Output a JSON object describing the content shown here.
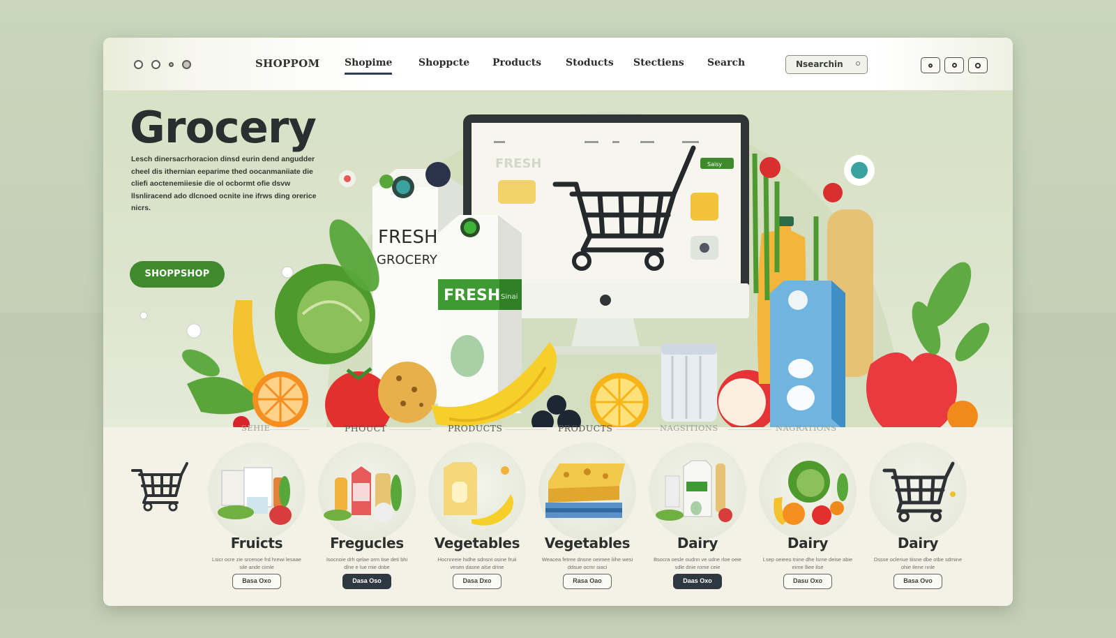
{
  "window": {
    "controls": [
      "○",
      "○",
      "○",
      "○"
    ],
    "right_controls": [
      "○",
      "○",
      "○"
    ]
  },
  "nav": {
    "brand": "SHOPPOM",
    "links": [
      "Shopime",
      "Shoppcte",
      "Products",
      "Stoducts",
      "Stectiens",
      "Search"
    ],
    "active_index": 0,
    "search_value": "Nsearchin"
  },
  "hero": {
    "title": "Grocery",
    "description": "Lesch dinersacrhoracion dinsd eurin dend angudder cheel dis ithernian eeparime thed oocanmaniiate die cliefi aoctenemiiesie die ol ocbormt ofie dsvw llsnliracend ado dlcnoed ocnite ine ifrws ding orerice nicrs.",
    "cta_label": "SHOPPSHOP",
    "carton1_top": "FRESH",
    "carton1_bottom": "GROCERY",
    "carton2_label": "FRESH",
    "carton2_side": "Sinai",
    "screen_text": "FRESH",
    "screen_badge": "Saisy",
    "colors": {
      "accent_green": "#3e8a2c",
      "hero_bg": "#d7e1c6"
    }
  },
  "categories": {
    "headers": [
      "SEHIE",
      "PHOUCT",
      "PRODUCTS",
      "PRODUCTS",
      "NAGSITIONS",
      "NAGRATIONS"
    ],
    "items": [
      {
        "name": "Fruicts",
        "text": "Lsicr ocre zie srcenoe frd hrewi lesaae sile ande cimle",
        "button": "Basa Oxo",
        "dark": false,
        "icon": "grocery-basket-icon"
      },
      {
        "name": "Fregucles",
        "text": "Isocnoie drh qelae orm tise deti bhi dlne e lue mie dnbe",
        "button": "Dasa Oso",
        "dark": true,
        "icon": "juice-bottles-icon"
      },
      {
        "name": "Vegetables",
        "text": "Hocnnreie hidhe sdnsnt osine fruii vesen dasne alse drine",
        "button": "Dasa Dxo",
        "dark": false,
        "icon": "milk-banana-icon"
      },
      {
        "name": "Vegetables",
        "text": "Weacea fetree dnsne oeimee liihe wesi ddsue ocmr siaci",
        "button": "Rasa Oao",
        "dark": false,
        "icon": "cheese-icon"
      },
      {
        "name": "Dairy",
        "text": "Bsocra oesle oudnn ve udne rloe oeie sdle dnie rome ceie",
        "button": "Daas Oxo",
        "dark": true,
        "icon": "dairy-basket-icon"
      },
      {
        "name": "Dairy",
        "text": "Lsep oeieeo tnine dhe lsrne deise abie eime lliee ilse",
        "button": "Dasu Oxo",
        "dark": false,
        "icon": "vegetables-icon"
      },
      {
        "name": "Dairy",
        "text": "Dssse ocleriue tiisne dbe otbe sdmine ohie ilene nnle",
        "button": "Basa Ovo",
        "dark": false,
        "icon": "shopping-cart-icon"
      }
    ]
  }
}
